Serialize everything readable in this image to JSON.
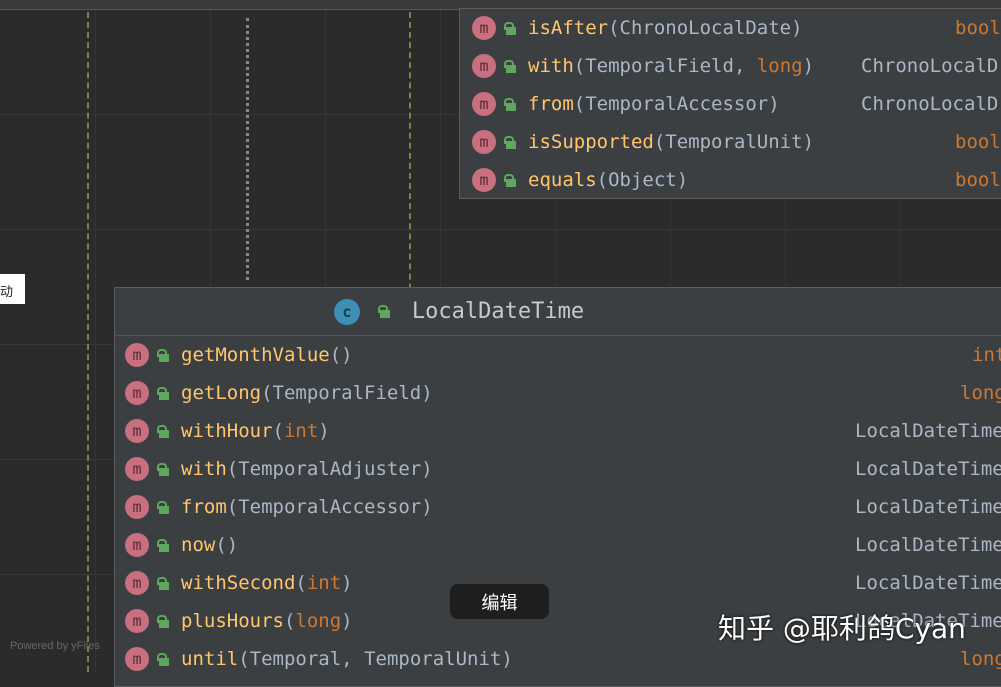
{
  "side_label": "动",
  "top_popup": {
    "rows": [
      {
        "name": "isAfter",
        "params": [
          {
            "t": "ChronoLocalDate",
            "k": false
          }
        ],
        "ret": "bool",
        "ret_kw": true
      },
      {
        "name": "with",
        "params": [
          {
            "t": "TemporalField",
            "k": false
          },
          {
            "t": "long",
            "k": true
          }
        ],
        "ret": "ChronoLocalD",
        "ret_kw": false
      },
      {
        "name": "from",
        "params": [
          {
            "t": "TemporalAccessor",
            "k": false
          }
        ],
        "ret": "ChronoLocalD",
        "ret_kw": false
      },
      {
        "name": "isSupported",
        "params": [
          {
            "t": "TemporalUnit",
            "k": false
          }
        ],
        "ret": "bool",
        "ret_kw": true
      },
      {
        "name": "equals",
        "params": [
          {
            "t": "Object",
            "k": false
          }
        ],
        "ret": "bool",
        "ret_kw": true
      }
    ]
  },
  "class_popup": {
    "title": "LocalDateTime",
    "class_icon": "c",
    "rows": [
      {
        "name": "getMonthValue",
        "params": [],
        "ret": "int",
        "ret_kw": true
      },
      {
        "name": "getLong",
        "params": [
          {
            "t": "TemporalField",
            "k": false
          }
        ],
        "ret": "long",
        "ret_kw": true
      },
      {
        "name": "withHour",
        "params": [
          {
            "t": "int",
            "k": true
          }
        ],
        "ret": "LocalDateTime",
        "ret_kw": false
      },
      {
        "name": "with",
        "params": [
          {
            "t": "TemporalAdjuster",
            "k": false
          }
        ],
        "ret": "LocalDateTime",
        "ret_kw": false
      },
      {
        "name": "from",
        "params": [
          {
            "t": "TemporalAccessor",
            "k": false
          }
        ],
        "ret": "LocalDateTime",
        "ret_kw": false
      },
      {
        "name": "now",
        "params": [],
        "ret": "LocalDateTime",
        "ret_kw": false
      },
      {
        "name": "withSecond",
        "params": [
          {
            "t": "int",
            "k": true
          }
        ],
        "ret": "LocalDateTime",
        "ret_kw": false
      },
      {
        "name": "plusHours",
        "params": [
          {
            "t": "long",
            "k": true
          }
        ],
        "ret": "LocalDateTime",
        "ret_kw": false
      },
      {
        "name": "until",
        "params": [
          {
            "t": "Temporal",
            "k": false
          },
          {
            "t": "TemporalUnit",
            "k": false
          }
        ],
        "ret": "long",
        "ret_kw": true
      }
    ]
  },
  "method_icon": "m",
  "edit_button": "编辑",
  "watermark": "知乎 @耶利鸽Cyan",
  "powered_by": "Powered by yFiles"
}
